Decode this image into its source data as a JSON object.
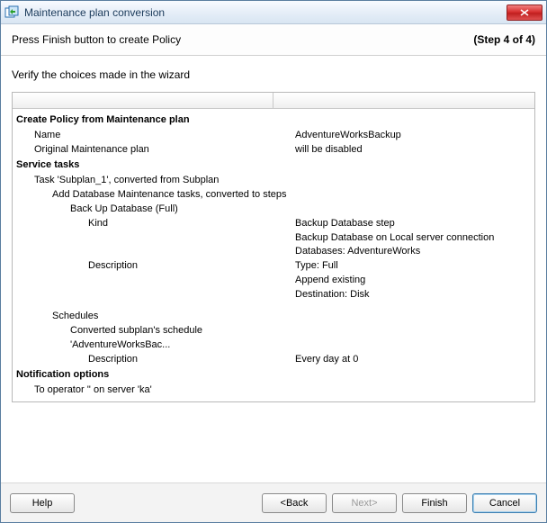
{
  "window": {
    "title": "Maintenance plan conversion"
  },
  "subheader": {
    "text": "Press Finish button to create Policy",
    "step": "(Step 4 of 4)"
  },
  "content": {
    "verify": "Verify the choices made in the wizard",
    "sec1": {
      "title": "Create Policy from Maintenance plan"
    },
    "name_label": "Name",
    "name_value": "AdventureWorksBackup",
    "orig_label": "Original Maintenance plan",
    "orig_value": "will be disabled",
    "sec2": {
      "title": "Service tasks"
    },
    "task_line": "Task 'Subplan_1', converted from Subplan",
    "add_line": "Add Database Maintenance tasks, converted to steps",
    "backup_line": "Back Up Database (Full)",
    "kind_label": "Kind",
    "kind_value": "Backup Database step",
    "desc_label": "Description",
    "desc_l1": "Backup Database on Local server connection",
    "desc_l2": "Databases: AdventureWorks",
    "desc_l3": "Type: Full",
    "desc_l4": "Append existing",
    "desc_l5": "Destination: Disk",
    "sched_label": "Schedules",
    "sched_conv": "Converted subplan's schedule 'AdventureWorksBac...",
    "sched_desc_label": "Description",
    "sched_desc_value": "Every day at 0",
    "sec3": {
      "title": "Notification options"
    },
    "notif_line": "To operator '' on server 'ka'"
  },
  "buttons": {
    "help": "Help",
    "back": "<Back",
    "next": "Next>",
    "finish": "Finish",
    "cancel": "Cancel"
  }
}
